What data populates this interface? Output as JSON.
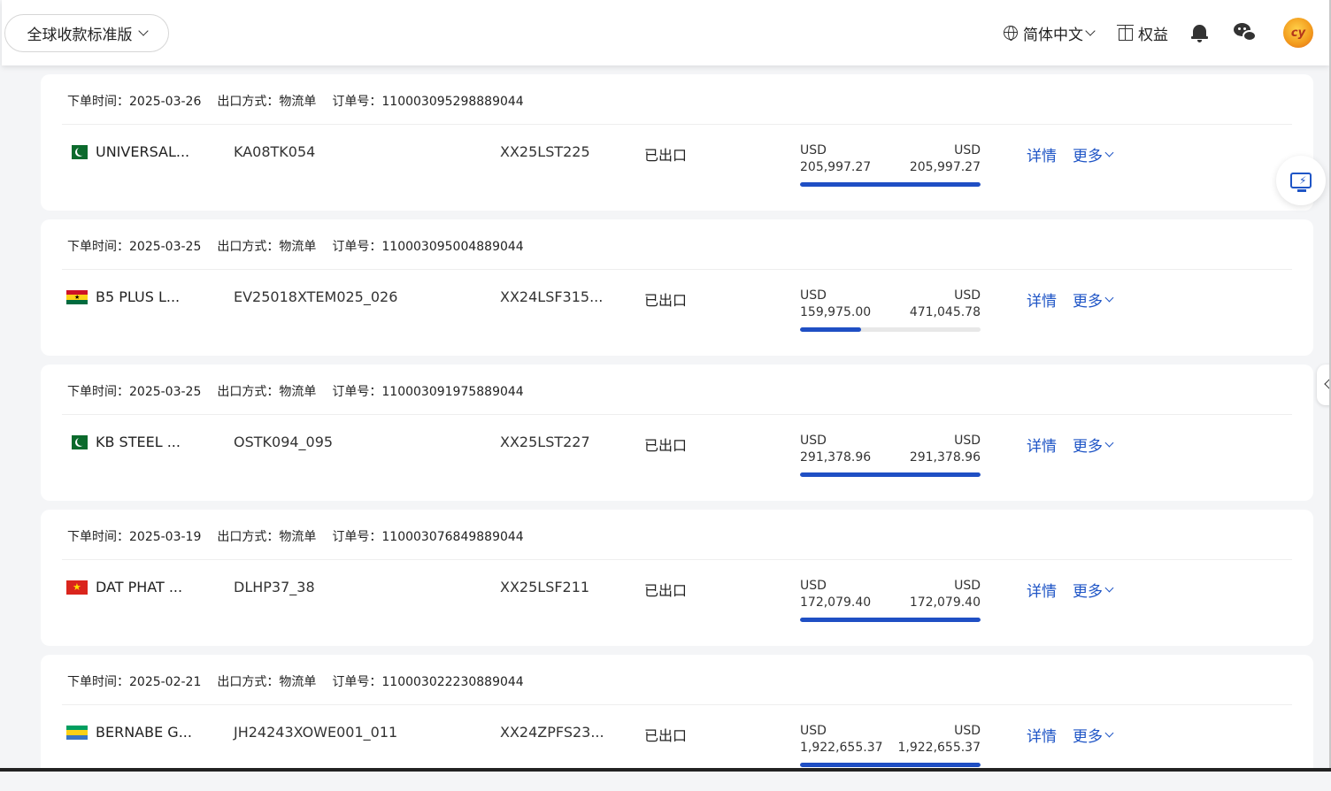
{
  "header": {
    "version_label": "全球收款标准版",
    "language_label": "简体中文",
    "benefits_label": "权益",
    "avatar_text": "cy"
  },
  "labels": {
    "order_time": "下单时间：",
    "export_method": "出口方式：",
    "order_no": "订单号：",
    "detail": "详情",
    "more": "更多"
  },
  "orders": [
    {
      "order_time": "2025-03-26",
      "export_method": "物流单",
      "order_no": "110003095298889044",
      "flag": "pakistan-flag",
      "buyer": "UNIVERSAL...",
      "invoice": "KA08TK054",
      "reference": "XX25LST225",
      "status": "已出口",
      "currency_left": "USD",
      "amount_left": "205,997.27",
      "currency_right": "USD",
      "amount_right": "205,997.27",
      "progress": 1.0
    },
    {
      "order_time": "2025-03-25",
      "export_method": "物流单",
      "order_no": "110003095004889044",
      "flag": "ghana-flag",
      "buyer": "B5 PLUS L...",
      "invoice": "EV25018XTEM025_026",
      "reference": "XX24LSF315...",
      "status": "已出口",
      "currency_left": "USD",
      "amount_left": "159,975.00",
      "currency_right": "USD",
      "amount_right": "471,045.78",
      "progress": 0.34
    },
    {
      "order_time": "2025-03-25",
      "export_method": "物流单",
      "order_no": "110003091975889044",
      "flag": "pakistan-flag",
      "buyer": "KB STEEL ...",
      "invoice": "OSTK094_095",
      "reference": "XX25LST227",
      "status": "已出口",
      "currency_left": "USD",
      "amount_left": "291,378.96",
      "currency_right": "USD",
      "amount_right": "291,378.96",
      "progress": 1.0
    },
    {
      "order_time": "2025-03-19",
      "export_method": "物流单",
      "order_no": "110003076849889044",
      "flag": "vietnam-flag",
      "buyer": "DAT PHAT ...",
      "invoice": "DLHP37_38",
      "reference": "XX25LSF211",
      "status": "已出口",
      "currency_left": "USD",
      "amount_left": "172,079.40",
      "currency_right": "USD",
      "amount_right": "172,079.40",
      "progress": 1.0
    },
    {
      "order_time": "2025-02-21",
      "export_method": "物流单",
      "order_no": "110003022230889044",
      "flag": "gabon-flag",
      "buyer": "BERNABE G...",
      "invoice": "JH24243XOWE001_011",
      "reference": "XX24ZPFS23...",
      "status": "已出口",
      "currency_left": "USD",
      "amount_left": "1,922,655.37",
      "currency_right": "USD",
      "amount_right": "1,922,655.37",
      "progress": 1.0
    }
  ]
}
